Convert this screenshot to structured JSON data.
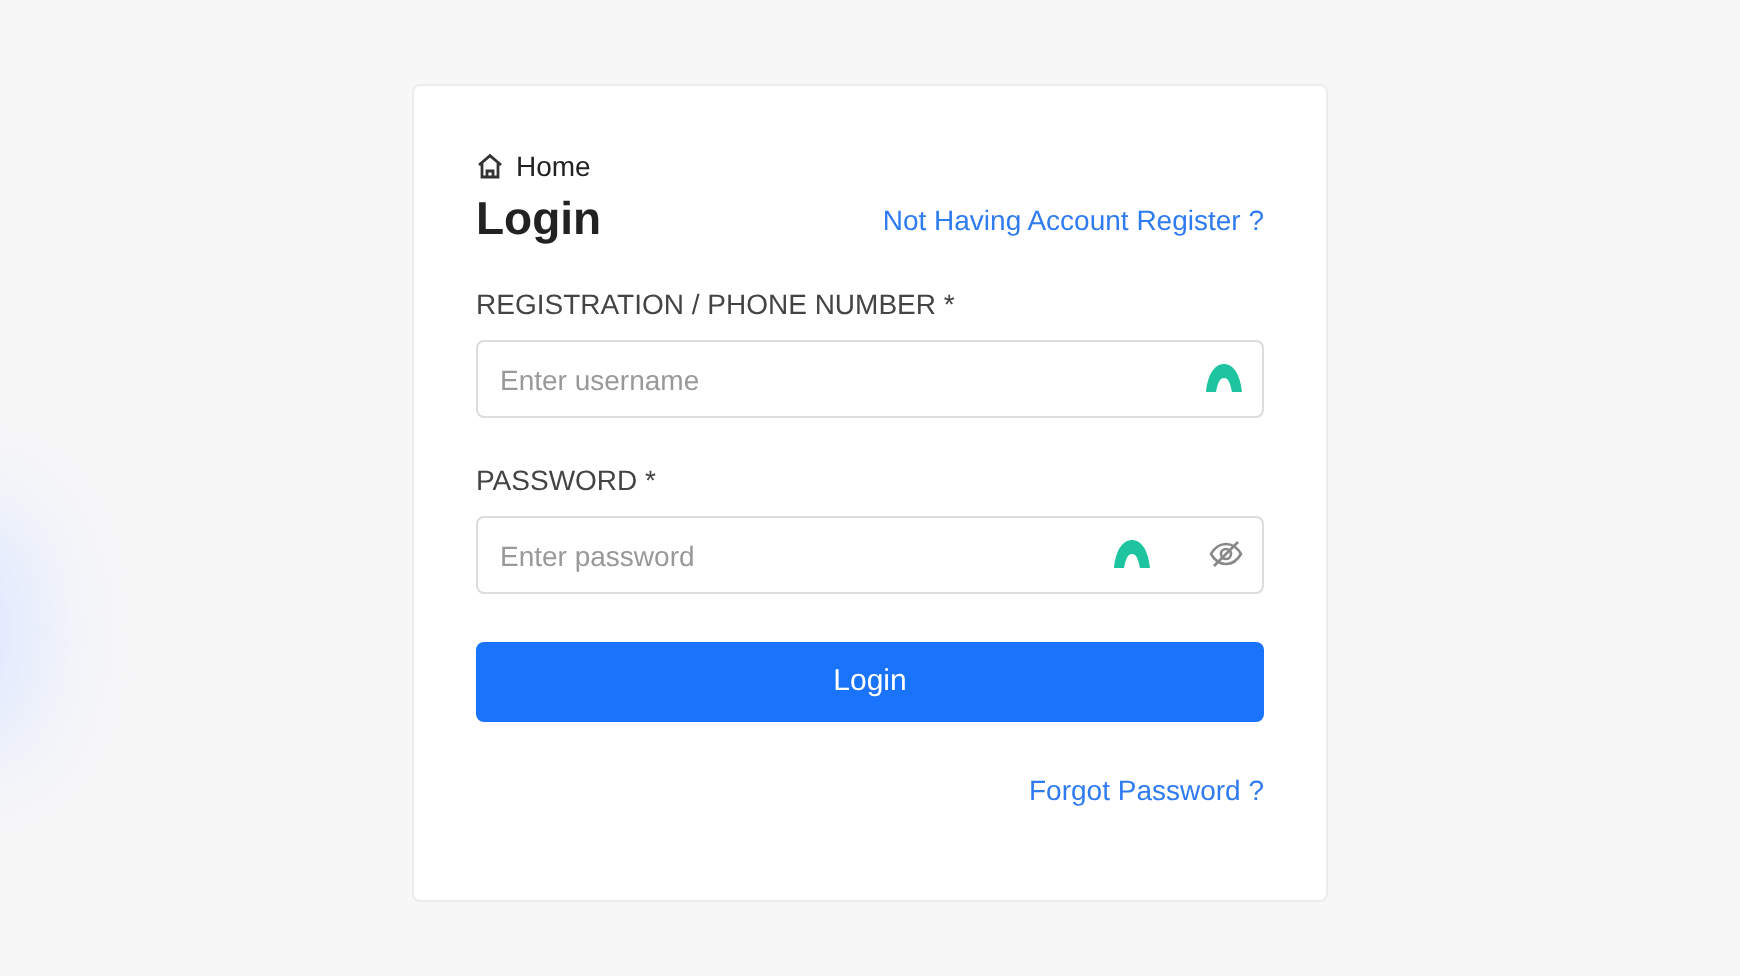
{
  "breadcrumb": "Home",
  "title": "Login",
  "register_link": "Not Having Account Register ?",
  "fields": [
    {
      "label": "REGISTRATION / PHONE NUMBER *",
      "placeholder": "Enter username",
      "kind": "text"
    },
    {
      "label": "PASSWORD *",
      "placeholder": "Enter password",
      "kind": "password"
    }
  ],
  "submit": "Login",
  "forgot_link": "Forgot Password ?"
}
